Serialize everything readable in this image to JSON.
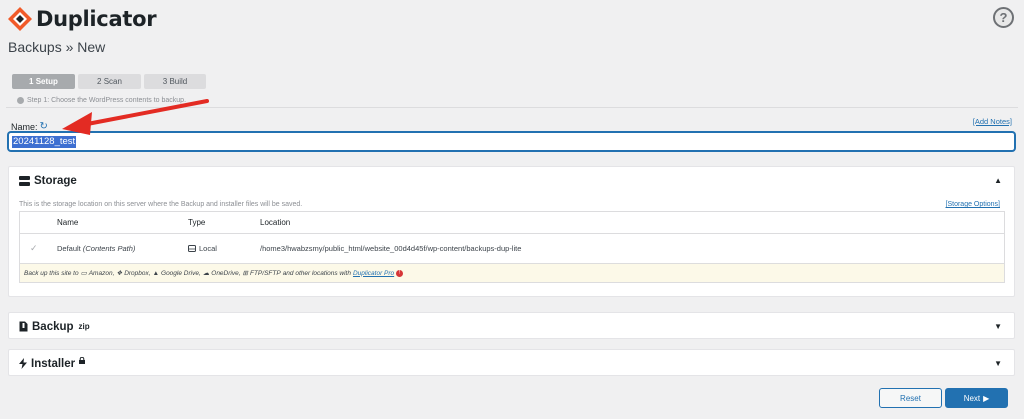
{
  "header": {
    "app_name": "Duplicator",
    "help_label": "?"
  },
  "page": {
    "breadcrumb": "Backups » New"
  },
  "steps": [
    {
      "label": "1 Setup",
      "active": true
    },
    {
      "label": "2 Scan",
      "active": false
    },
    {
      "label": "3 Build",
      "active": false
    }
  ],
  "step_description": "Step 1: Choose the WordPress contents to backup.",
  "name_field": {
    "label": "Name:",
    "value": "20241128_test",
    "add_notes": "[Add Notes]"
  },
  "storage": {
    "title": "Storage",
    "description": "This is the storage location on this server where the Backup and installer files will be saved.",
    "options_link": "[Storage Options]",
    "columns": [
      "Name",
      "Type",
      "Location"
    ],
    "rows": [
      {
        "name": "Default",
        "name_note": "(Contents Path)",
        "type": "Local",
        "location": "/home3/hwabzsmy/public_html/website_00d4d45f/wp-content/backups-dup-lite"
      }
    ],
    "footer": {
      "prefix": "Back up this site to",
      "providers": [
        "Amazon,",
        "Dropbox,",
        "Google Drive,",
        "OneDrive,",
        "FTP/SFTP"
      ],
      "suffix": "and other locations with",
      "link": "Duplicator Pro"
    }
  },
  "backup_panel": {
    "title": "Backup",
    "sup": "zip"
  },
  "installer_panel": {
    "title": "Installer"
  },
  "buttons": {
    "reset": "Reset",
    "next": "Next"
  },
  "colors": {
    "accent": "#2271b1",
    "brand_orange": "#f15a29",
    "annotation_arrow": "#e32b23"
  }
}
